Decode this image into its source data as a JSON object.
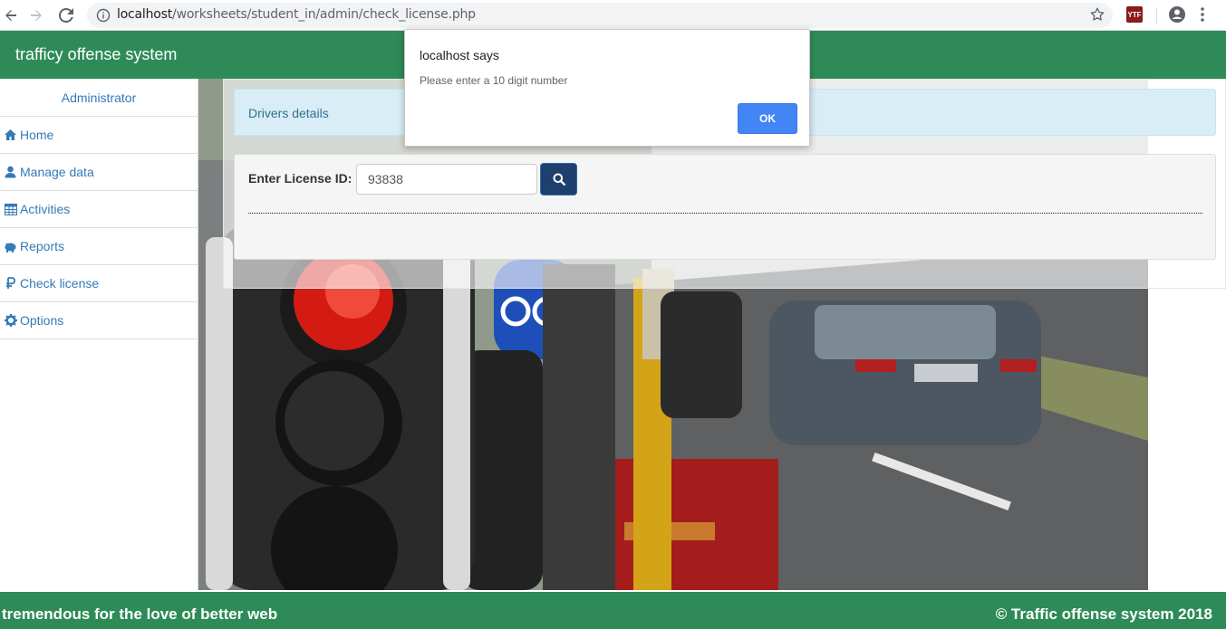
{
  "browser": {
    "url_host": "localhost",
    "url_path": "/worksheets/student_in/admin/check_license.php",
    "extension_label": "YTF"
  },
  "header": {
    "title": "trafficy offense system"
  },
  "sidebar": {
    "role": "Administrator",
    "items": [
      {
        "label": "Home",
        "icon": "home-icon"
      },
      {
        "label": "Manage data",
        "icon": "user-icon"
      },
      {
        "label": "Activities",
        "icon": "table-icon"
      },
      {
        "label": "Reports",
        "icon": "piggy-bank-icon"
      },
      {
        "label": "Check license",
        "icon": "ruble-icon"
      },
      {
        "label": "Options",
        "icon": "gear-icon"
      }
    ]
  },
  "main": {
    "panel_title": "Drivers details",
    "license_label": "Enter License ID:",
    "license_value": "93838"
  },
  "alert": {
    "title": "localhost says",
    "message": "Please enter a 10 digit number",
    "ok_label": "OK"
  },
  "footer": {
    "left": "tremendous for the love of better web",
    "right": "© Traffic offense system 2018"
  },
  "colors": {
    "brand": "#2e8b57",
    "link": "#337ab7",
    "alert_button": "#4285f4",
    "search_button": "#1f3f6e"
  }
}
